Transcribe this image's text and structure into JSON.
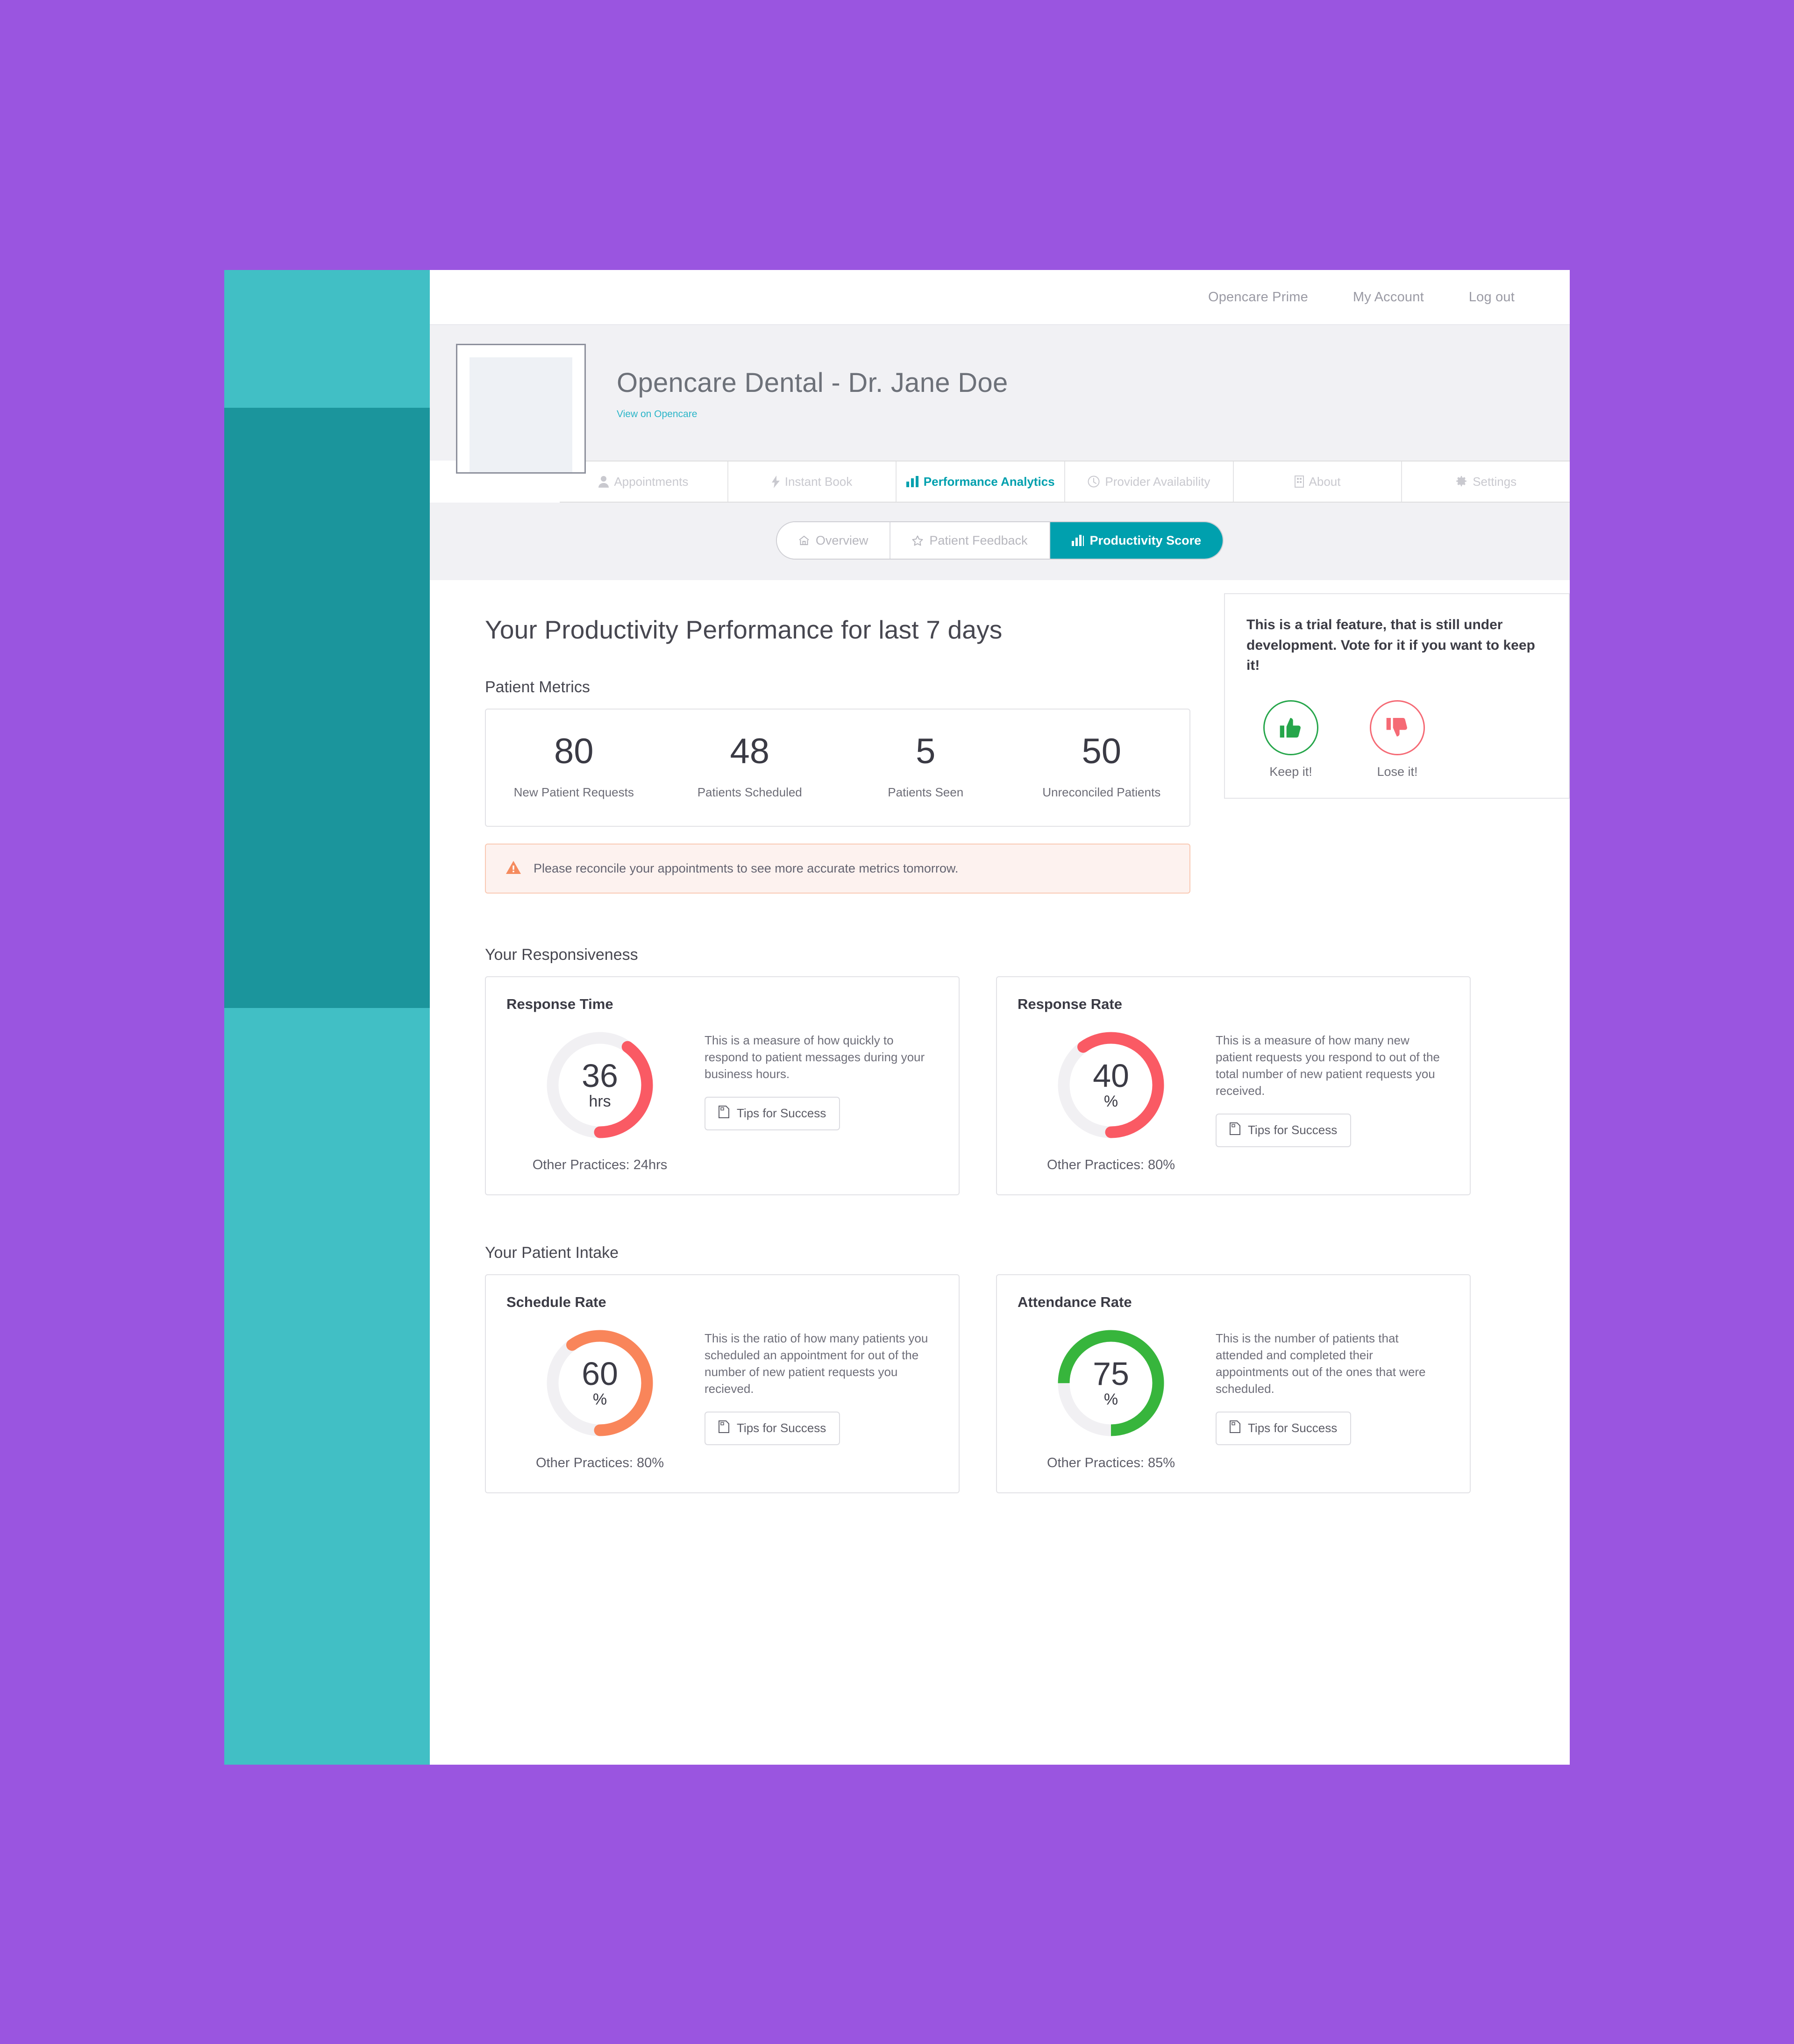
{
  "topnav": {
    "links": [
      {
        "label": "Opencare Prime"
      },
      {
        "label": "My Account"
      },
      {
        "label": "Log out"
      }
    ]
  },
  "profile": {
    "title": "Opencare Dental - Dr. Jane Doe",
    "view_link": "View on Opencare"
  },
  "main_tabs": [
    {
      "label": "Appointments",
      "icon": "person-icon",
      "active": false
    },
    {
      "label": "Instant Book",
      "icon": "bolt-icon",
      "active": false
    },
    {
      "label": "Performance Analytics",
      "icon": "bar-chart-icon",
      "active": true
    },
    {
      "label": "Provider Availability",
      "icon": "clock-icon",
      "active": false
    },
    {
      "label": "About",
      "icon": "building-icon",
      "active": false
    },
    {
      "label": "Settings",
      "icon": "gear-icon",
      "active": false
    }
  ],
  "sub_tabs": [
    {
      "label": "Overview",
      "icon": "home-icon",
      "active": false
    },
    {
      "label": "Patient Feedback",
      "icon": "star-icon",
      "active": false
    },
    {
      "label": "Productivity Score",
      "icon": "bar-chart-icon",
      "active": true
    }
  ],
  "page": {
    "heading": "Your Productivity Performance for last 7 days",
    "section_metrics": "Patient Metrics",
    "section_responsiveness": "Your Responsiveness",
    "section_intake": "Your Patient Intake"
  },
  "trial": {
    "message": "This is a trial feature, that is still under development. Vote for it if you want to keep it!",
    "keep_label": "Keep it!",
    "lose_label": "Lose it!",
    "keep_color": "#26a64b",
    "lose_color": "#f56a75"
  },
  "alert": {
    "text": "Please reconcile your appointments to see more accurate metrics tomorrow.",
    "icon": "warning-triangle-icon",
    "color": "#f58b5e"
  },
  "chart_data": [
    {
      "type": "table",
      "title": "Patient Metrics",
      "categories": [
        "New Patient Requests",
        "Patients Scheduled",
        "Patients Seen",
        "Unreconciled Patients"
      ],
      "values": [
        80,
        48,
        5,
        50
      ]
    },
    {
      "type": "pie",
      "title": "Response Time",
      "value": 36,
      "unit": "hrs",
      "display_value": "36",
      "fraction": 0.4,
      "color": "#fa5a64",
      "track_color": "#f1f0f3",
      "benchmark_label": "Other Practices: 24hrs",
      "benchmark_value": 24,
      "description": "This is a measure of how quickly to respond to patient messages during your business hours.",
      "button": "Tips for Success"
    },
    {
      "type": "pie",
      "title": "Response Rate",
      "value": 40,
      "unit": "%",
      "display_value": "40",
      "fraction": 0.6,
      "color": "#fa5a64",
      "track_color": "#f1f0f3",
      "benchmark_label": "Other Practices: 80%",
      "benchmark_value": 80,
      "description": "This is a measure of how many new patient requests you respond to out of the total number of new patient requests you received.",
      "button": "Tips for Success"
    },
    {
      "type": "pie",
      "title": "Schedule Rate",
      "value": 60,
      "unit": "%",
      "display_value": "60",
      "fraction": 0.6,
      "color": "#f9855a",
      "track_color": "#f1f0f3",
      "benchmark_label": "Other Practices: 80%",
      "benchmark_value": 80,
      "description": "This is the ratio of how many patients you scheduled an appointment for out of the number of new patient requests you recieved.",
      "button": "Tips for Success"
    },
    {
      "type": "pie",
      "title": "Attendance Rate",
      "value": 75,
      "unit": "%",
      "display_value": "75",
      "fraction": 0.75,
      "color": "#37b53c",
      "track_color": "#f1f0f3",
      "benchmark_label": "Other Practices: 85%",
      "benchmark_value": 85,
      "description": "This is the number of patients that attended and completed their appointments out of the ones that were scheduled.",
      "button": "Tips for Success"
    }
  ],
  "theme": {
    "accent": "#00a0ae",
    "sidebar_light": "#41bfc5",
    "sidebar_dark": "#1b959c",
    "page_bg": "#9a55e0"
  }
}
